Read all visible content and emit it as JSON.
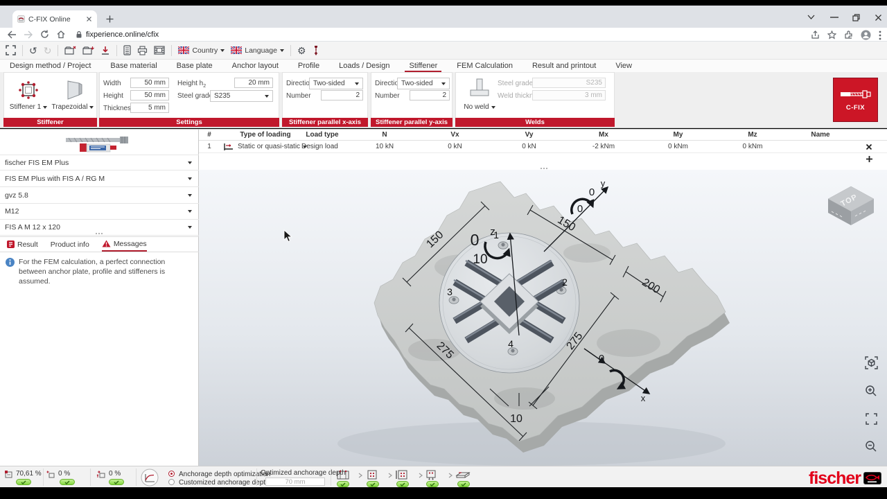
{
  "colors": {
    "accent_red": "#c0182c",
    "logo_red": "#e2001a",
    "status_green": "#7ac943",
    "info_blue": "#4a84c4"
  },
  "browser": {
    "tab_title": "C-FIX Online",
    "url": "fixperience.online/cfix"
  },
  "app_toolbar": {
    "country": "Country",
    "language": "Language"
  },
  "menu_tabs": [
    "Design method / Project",
    "Base material",
    "Base plate",
    "Anchor layout",
    "Profile",
    "Loads / Design",
    "Stiffener",
    "FEM Calculation",
    "Result and printout",
    "View"
  ],
  "ribbon": {
    "stiffener": {
      "title": "Stiffener",
      "selector": "Stiffener 1",
      "shape": "Trapezoidal"
    },
    "settings": {
      "title": "Settings",
      "width_label": "Width",
      "width": "50 mm",
      "height_label": "Height",
      "height": "50 mm",
      "thickness_label": "Thickness",
      "thickness": "5 mm",
      "h2_label": "Height h",
      "h2_sub": "2",
      "h2": "20 mm",
      "steel_label": "Steel grades",
      "steel": "S235"
    },
    "px": {
      "title": "Stiffener parallel x-axis",
      "direction_label": "Direction",
      "direction": "Two-sided",
      "number_label": "Number",
      "number": "2"
    },
    "py": {
      "title": "Stiffener parallel y-axis",
      "direction_label": "Direction",
      "direction": "Two-sided",
      "number_label": "Number",
      "number": "2"
    },
    "welds": {
      "title": "Welds",
      "mode": "No weld",
      "steel_label": "Steel grades",
      "steel": "S235",
      "thickness_label": "Weld thickness",
      "thickness": "3 mm"
    },
    "logo": "C-FIX"
  },
  "sidebar": {
    "selects": [
      "fischer FIS EM Plus",
      "FIS EM Plus with FIS A / RG M",
      "gvz 5.8",
      "M12",
      "FIS A M 12 x 120"
    ],
    "tabs": [
      "Result",
      "Product info",
      "Messages"
    ],
    "message": "For the FEM calculation, a perfect connection between anchor plate, profile and stiffeners is assumed."
  },
  "load_table": {
    "columns": [
      "#",
      "Type of loading",
      "Load type",
      "N",
      "Vx",
      "Vy",
      "Mx",
      "My",
      "Mz",
      "Name"
    ],
    "rows": [
      {
        "num": "1",
        "loading": "Static or quasi-static",
        "load_type": "Design load",
        "n": "10 kN",
        "vx": "0 kN",
        "vy": "0 kN",
        "mx": "-2 kNm",
        "my": "0 kNm",
        "mz": "0 kNm",
        "name": ""
      }
    ]
  },
  "viewport": {
    "cube": "TOP",
    "axis_x": "x",
    "axis_y": "y",
    "axis_z": "z",
    "anchors": [
      "1",
      "2",
      "3",
      "4"
    ],
    "dims": {
      "left150": "150",
      "right150": "150",
      "right200": "200",
      "left275": "275",
      "right275": "275",
      "bottom10": "10"
    },
    "loads": {
      "mz": "0",
      "n": "10",
      "vy": "0",
      "my": "0",
      "vx": "0"
    }
  },
  "statusbar": {
    "util_main": "70,61 %",
    "util_2": "0 %",
    "util_3": "0 %",
    "opt_radio": "Anchorage depth optimization",
    "custom_radio": "Customized anchorage depth",
    "opt_label": "Optimized anchorage depth",
    "opt_value": "70 mm"
  },
  "brand": "fischer"
}
